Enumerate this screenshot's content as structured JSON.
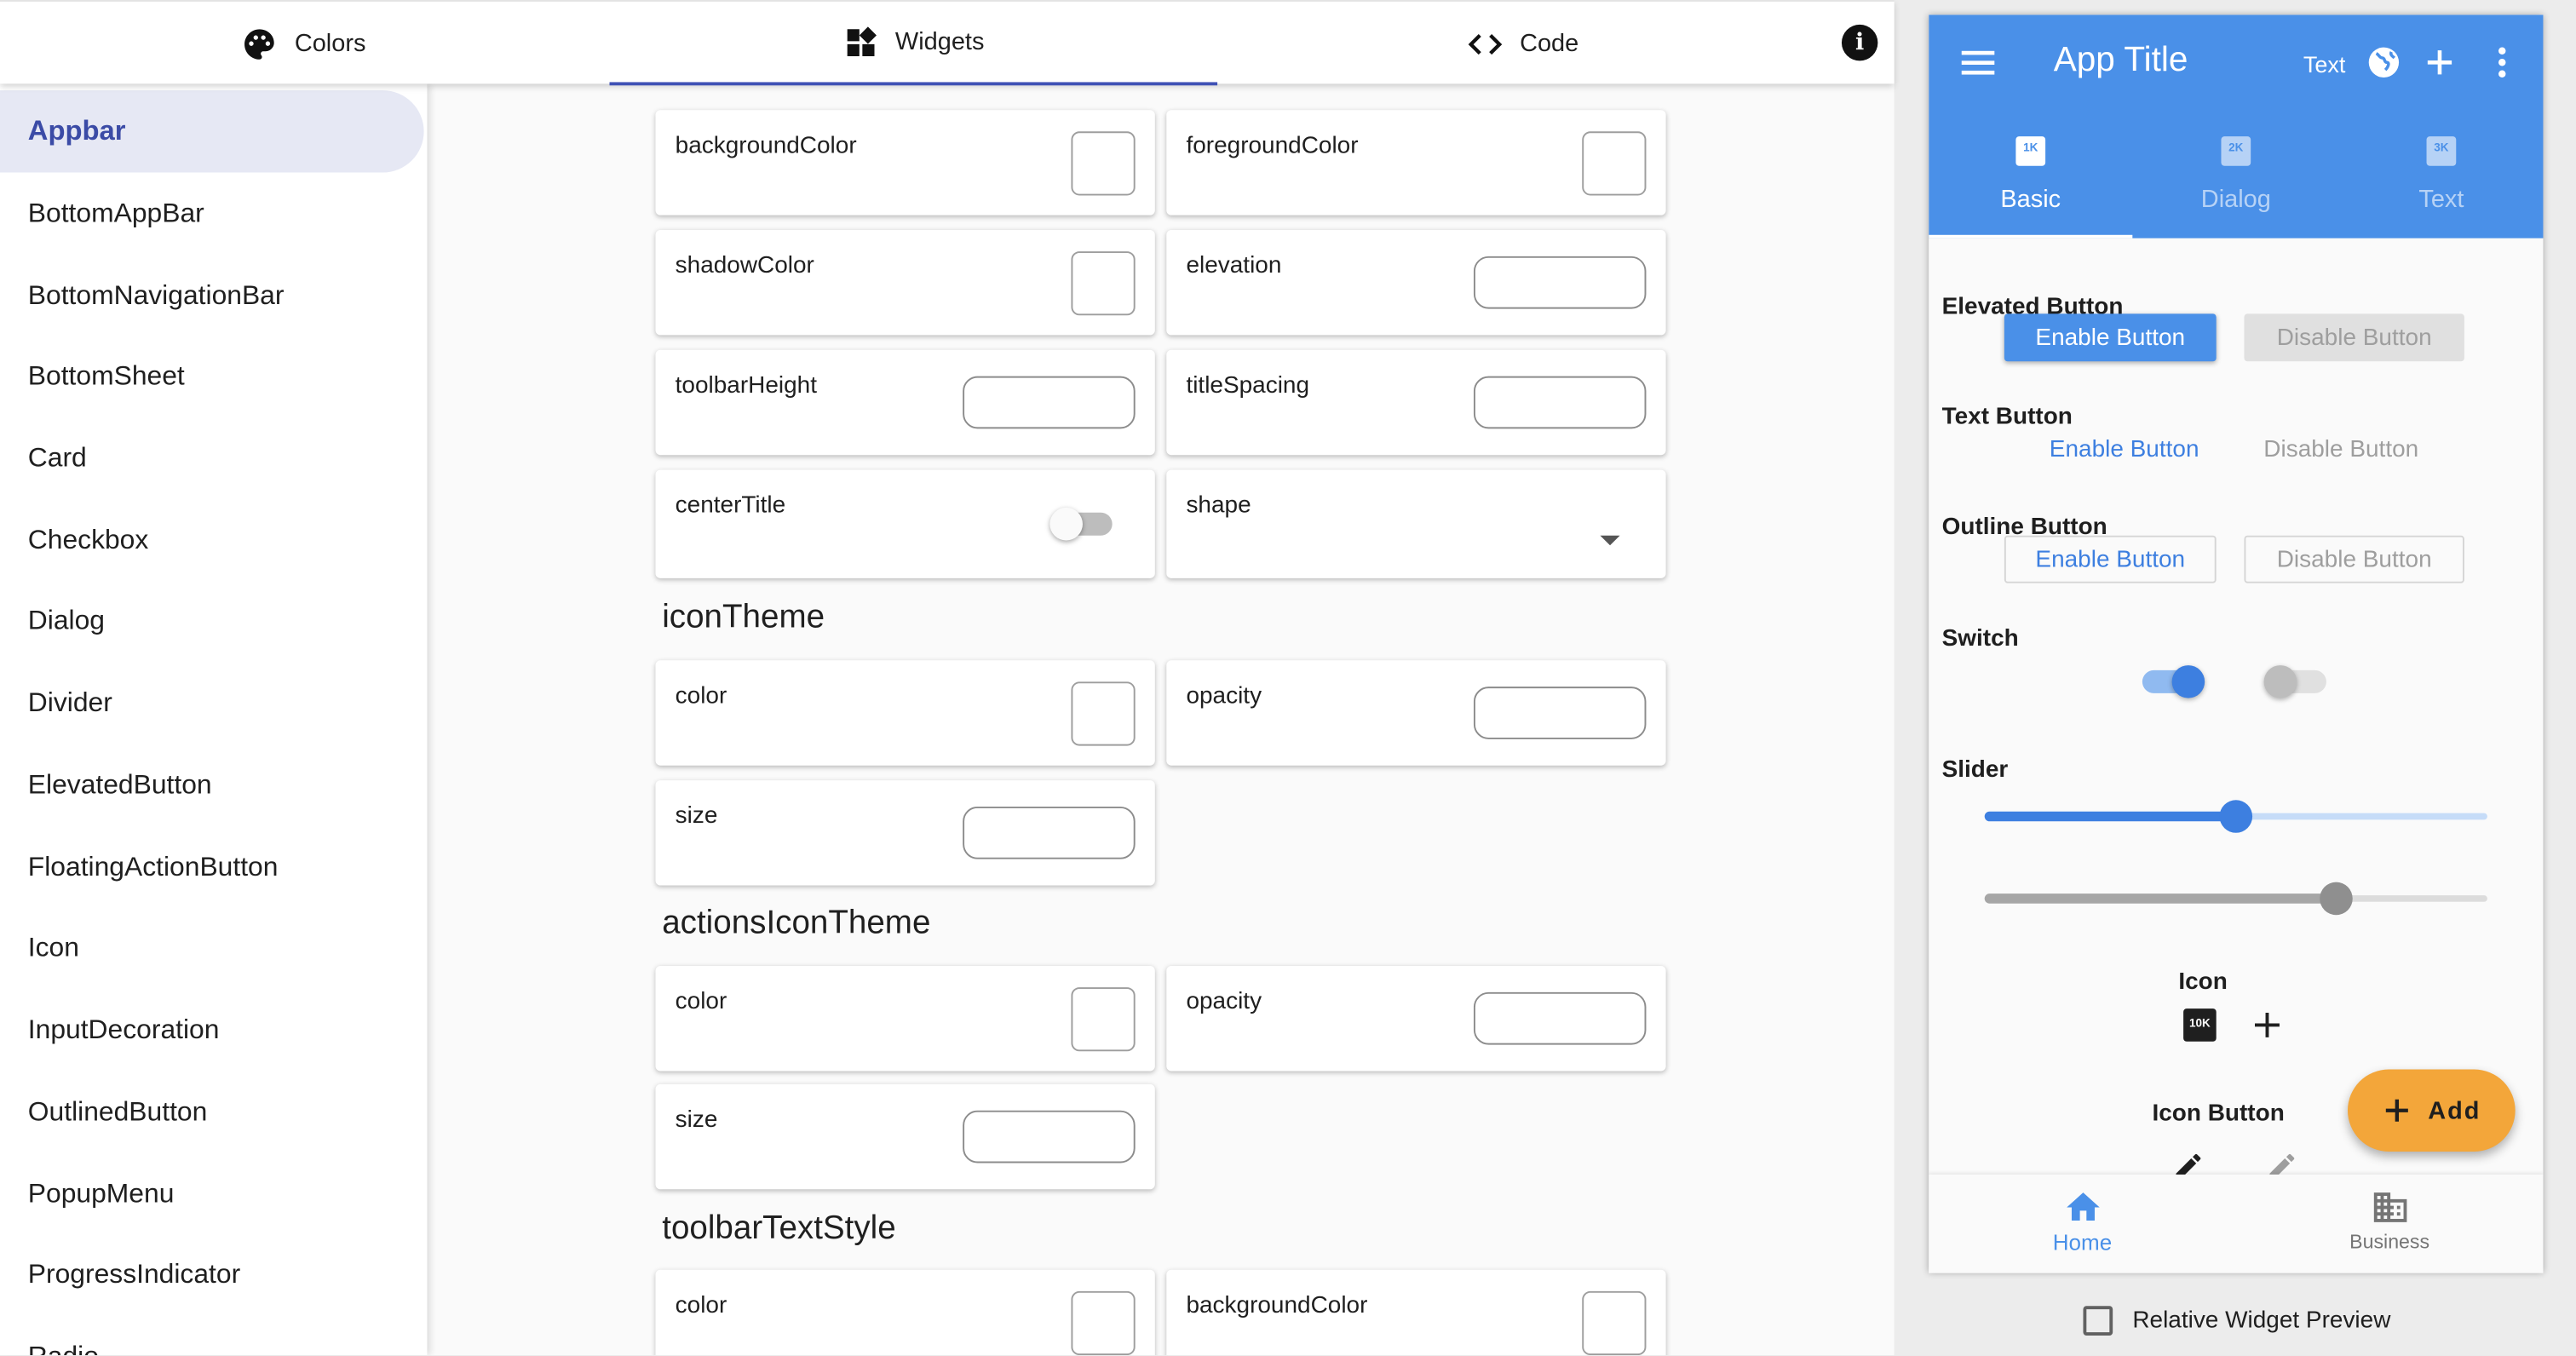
{
  "top_tabs": [
    {
      "label": "Colors",
      "icon": "palette-icon"
    },
    {
      "label": "Widgets",
      "icon": "widgets-icon",
      "active": true
    },
    {
      "label": "Code",
      "icon": "code-icon"
    }
  ],
  "info_button": {
    "glyph": "i"
  },
  "sidebar": {
    "items": [
      {
        "label": "Appbar",
        "active": true
      },
      {
        "label": "BottomAppBar"
      },
      {
        "label": "BottomNavigationBar"
      },
      {
        "label": "BottomSheet"
      },
      {
        "label": "Card"
      },
      {
        "label": "Checkbox"
      },
      {
        "label": "Dialog"
      },
      {
        "label": "Divider"
      },
      {
        "label": "ElevatedButton"
      },
      {
        "label": "FloatingActionButton"
      },
      {
        "label": "Icon"
      },
      {
        "label": "InputDecoration"
      },
      {
        "label": "OutlinedButton"
      },
      {
        "label": "PopupMenu"
      },
      {
        "label": "ProgressIndicator"
      },
      {
        "label": "Radio"
      }
    ]
  },
  "main": {
    "appbar_props": {
      "backgroundColor": "backgroundColor",
      "foregroundColor": "foregroundColor",
      "shadowColor": "shadowColor",
      "elevation": "elevation",
      "toolbarHeight": "toolbarHeight",
      "titleSpacing": "titleSpacing",
      "centerTitle": "centerTitle",
      "centerTitle_on": false,
      "shape": "shape"
    },
    "icon_theme": {
      "title": "iconTheme",
      "color": "color",
      "opacity": "opacity",
      "size": "size"
    },
    "actions_icon_theme": {
      "title": "actionsIconTheme",
      "color": "color",
      "opacity": "opacity",
      "size": "size"
    },
    "toolbar_text_style": {
      "title": "toolbarTextStyle",
      "color": "color",
      "backgroundColor": "backgroundColor"
    }
  },
  "preview": {
    "appbar": {
      "title": "App Title",
      "text_action": "Text",
      "color": "#4a90e8",
      "tabs": [
        {
          "badge": "1K",
          "label": "Basic",
          "active": true
        },
        {
          "badge": "2K",
          "label": "Dialog"
        },
        {
          "badge": "3K",
          "label": "Text"
        }
      ]
    },
    "elevated_button": {
      "title": "Elevated Button",
      "enable": "Enable Button",
      "disable": "Disable Button"
    },
    "text_button": {
      "title": "Text Button",
      "enable": "Enable Button",
      "disable": "Disable Button"
    },
    "outline_button": {
      "title": "Outline Button",
      "enable": "Enable Button",
      "disable": "Disable Button"
    },
    "switch": {
      "title": "Switch",
      "enabled_on": true,
      "disabled_on": false
    },
    "slider": {
      "title": "Slider",
      "enabled_value": 0.5,
      "disabled_value": 0.7
    },
    "icon": {
      "title": "Icon",
      "badge": "10K"
    },
    "icon_button": {
      "title": "Icon Button"
    },
    "fab": {
      "label": "Add",
      "color": "#f3a63a"
    },
    "bottom_nav": [
      {
        "label": "Home",
        "icon": "home-icon",
        "active": true
      },
      {
        "label": "Business",
        "icon": "business-icon"
      }
    ]
  },
  "relative_preview": {
    "label": "Relative Widget Preview",
    "checked": false
  }
}
